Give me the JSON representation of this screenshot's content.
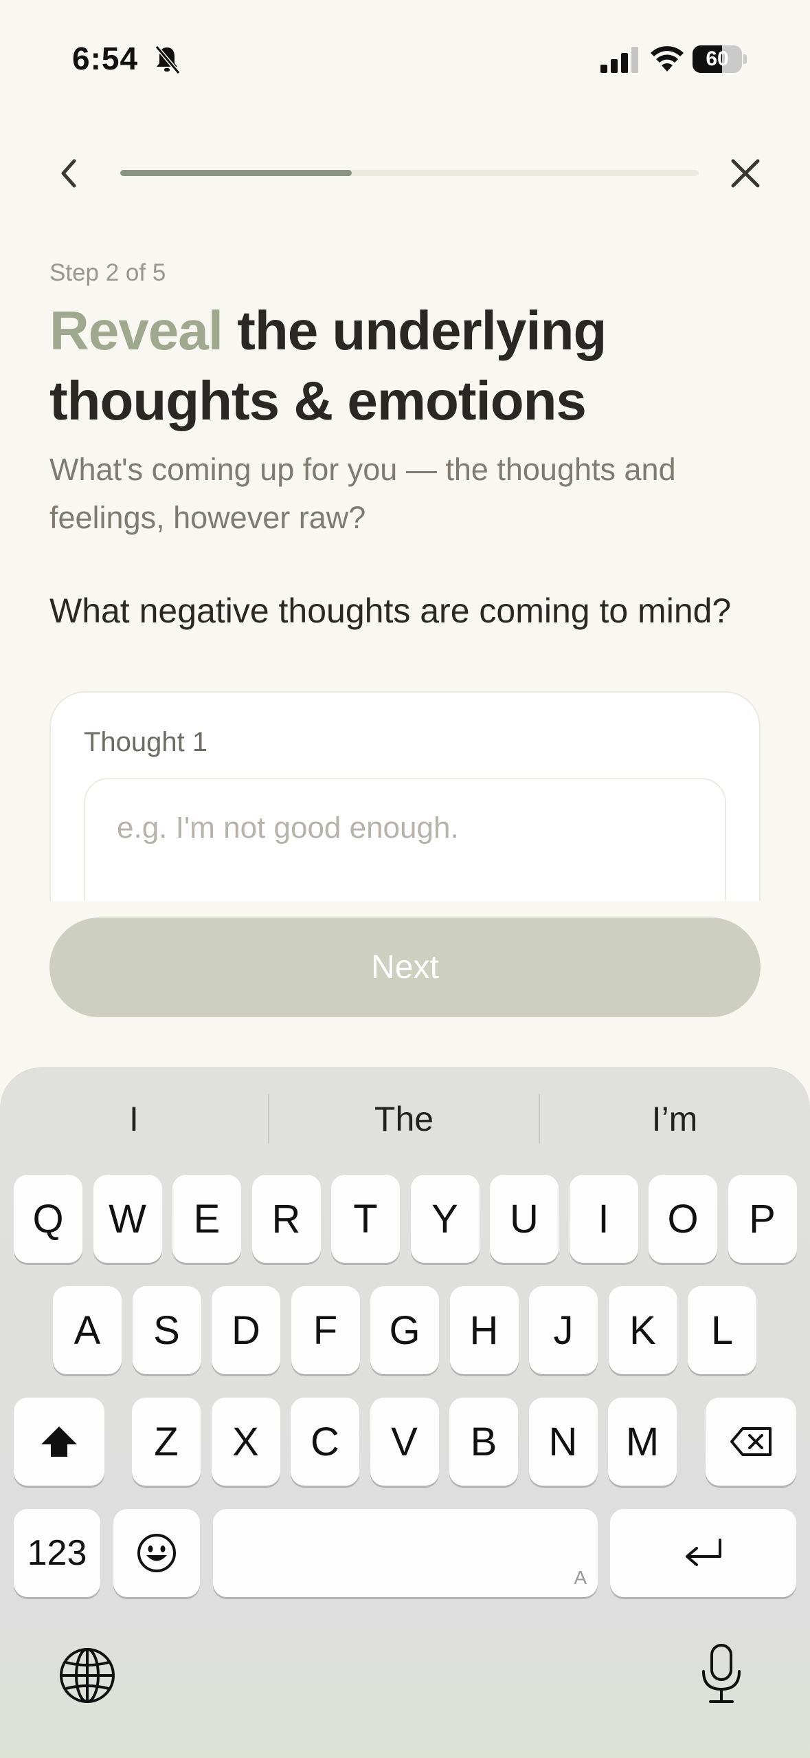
{
  "status_bar": {
    "time": "6:54",
    "battery": "60",
    "battery_fraction": 0.6
  },
  "header": {
    "progress_fraction": 0.4
  },
  "content": {
    "step_label": "Step 2 of 5",
    "heading_accent": "Reveal",
    "heading_rest": " the underlying thoughts & emotions",
    "subtitle": "What's coming up for you — the thoughts and feelings, however raw?",
    "question": "What negative thoughts are coming to mind?",
    "thought_label": "Thought 1",
    "thought_placeholder": "e.g. I'm not good enough.",
    "thought_value": "",
    "next_label": "Next"
  },
  "keyboard": {
    "suggestions": [
      "I",
      "The",
      "I’m"
    ],
    "row1": [
      "Q",
      "W",
      "E",
      "R",
      "T",
      "Y",
      "U",
      "I",
      "O",
      "P"
    ],
    "row2": [
      "A",
      "S",
      "D",
      "F",
      "G",
      "H",
      "J",
      "K",
      "L"
    ],
    "row3": [
      "Z",
      "X",
      "C",
      "V",
      "B",
      "N",
      "M"
    ],
    "numbers_label": "123",
    "space_hint": "A",
    "icons": {
      "shift": "shift-icon",
      "delete": "delete-icon",
      "emoji": "emoji-icon",
      "return": "return-icon",
      "globe": "globe-icon",
      "mic": "microphone-icon"
    }
  },
  "colors": {
    "background": "#f9f7f1",
    "accent": "#a0a98f",
    "progress": "#8b9580",
    "button_disabled": "#cdcfc0"
  }
}
